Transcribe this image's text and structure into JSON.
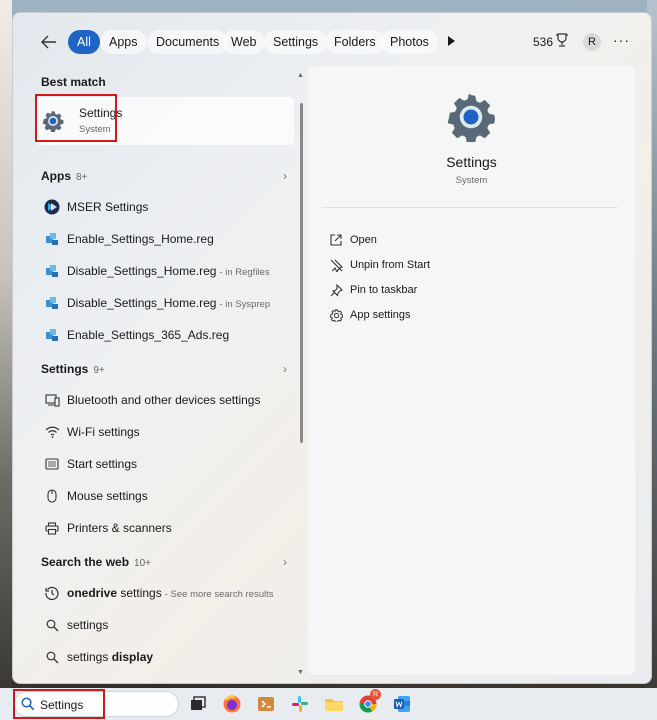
{
  "filters": {
    "tabs": [
      "All",
      "Apps",
      "Documents",
      "Web",
      "Settings",
      "Folders",
      "Photos"
    ],
    "active": "All",
    "points": "536",
    "avatar_letter": "R",
    "more": "···"
  },
  "left": {
    "best_match_heading": "Best match",
    "best_match": {
      "title": "Settings",
      "subtitle": "System"
    },
    "apps_heading": "Apps",
    "apps_count": "8+",
    "apps": [
      {
        "name": "MSER Settings",
        "sub": ""
      },
      {
        "name": "Enable_Settings_Home.reg",
        "sub": ""
      },
      {
        "name": "Disable_Settings_Home.reg",
        "sub": "- in Regfiles"
      },
      {
        "name": "Disable_Settings_Home.reg",
        "sub": "- in Sysprep"
      },
      {
        "name": "Enable_Settings_365_Ads.reg",
        "sub": ""
      }
    ],
    "settings_heading": "Settings",
    "settings_count": "9+",
    "settings": [
      "Bluetooth and other devices settings",
      "Wi-Fi settings",
      "Start settings",
      "Mouse settings",
      "Printers & scanners"
    ],
    "web_heading": "Search the web",
    "web_count": "10+",
    "web": [
      {
        "bold": "onedrive",
        "normal": " settings",
        "sub": "- See more search results"
      },
      {
        "bold": "",
        "normal": "settings",
        "sub": ""
      },
      {
        "bold": "display",
        "normal": "settings ",
        "sub": ""
      }
    ]
  },
  "right": {
    "title": "Settings",
    "subtitle": "System",
    "actions": [
      "Open",
      "Unpin from Start",
      "Pin to taskbar",
      "App settings"
    ]
  },
  "taskbar": {
    "search_value": "Settings",
    "apps": [
      "task-view-icon",
      "firefox-icon",
      "package-icon",
      "slack-icon",
      "file-explorer-icon",
      "chrome-icon",
      "word-icon"
    ],
    "chrome_badge": "R"
  }
}
